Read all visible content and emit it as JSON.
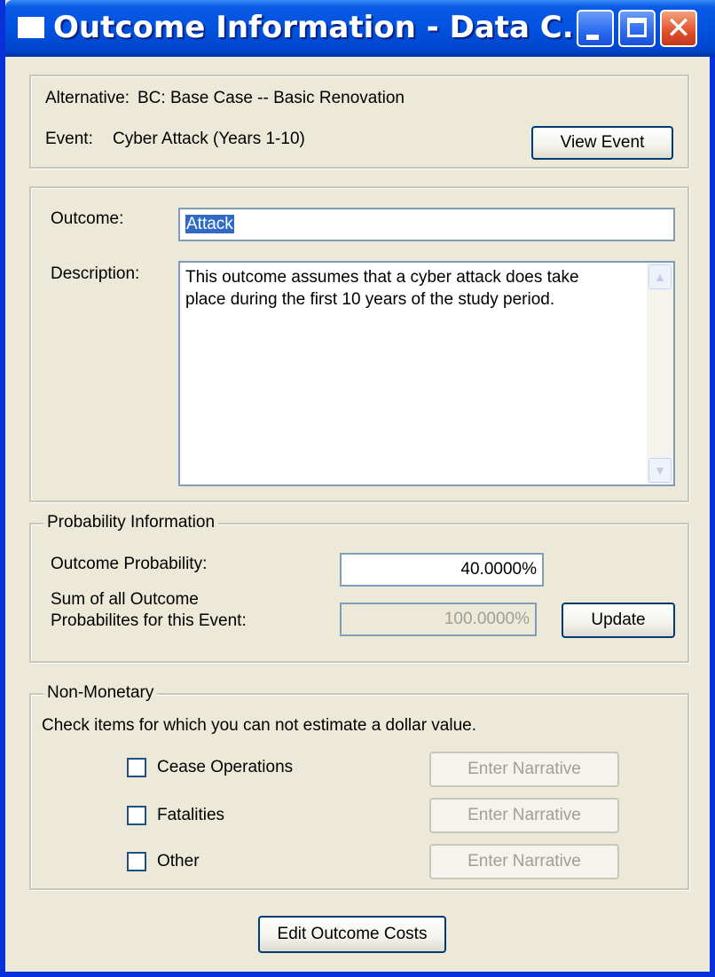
{
  "window": {
    "title": "Outcome Information - Data C...",
    "controls": {
      "minimize": "minimize",
      "maximize": "maximize",
      "close": "✕"
    }
  },
  "context": {
    "alternative_label": "Alternative:",
    "alternative_value": "BC: Base Case -- Basic Renovation",
    "event_label": "Event:",
    "event_value": "Cyber Attack (Years 1-10)",
    "view_event_button": "View Event"
  },
  "outcome": {
    "name_label": "Outcome:",
    "name_value": "Attack",
    "description_label": "Description:",
    "description_value": "This outcome assumes that a cyber attack does take\nplace during the first 10 years of the study period."
  },
  "probability": {
    "legend": "Probability Information",
    "outcome_probability_label": "Outcome Probability:",
    "outcome_probability_value": "40.0000%",
    "sum_label_line1": "Sum of all Outcome",
    "sum_label_line2": "Probabilites for this Event:",
    "sum_value": "100.0000%",
    "update_button": "Update"
  },
  "non_monetary": {
    "legend": "Non-Monetary",
    "instructions": "Check items for which you can not estimate a dollar value.",
    "items": [
      {
        "label": "Cease Operations",
        "checked": false,
        "narrative_button": "Enter Narrative"
      },
      {
        "label": "Fatalities",
        "checked": false,
        "narrative_button": "Enter Narrative"
      },
      {
        "label": "Other",
        "checked": false,
        "narrative_button": "Enter Narrative"
      }
    ]
  },
  "footer": {
    "edit_costs_button": "Edit Outcome Costs"
  }
}
